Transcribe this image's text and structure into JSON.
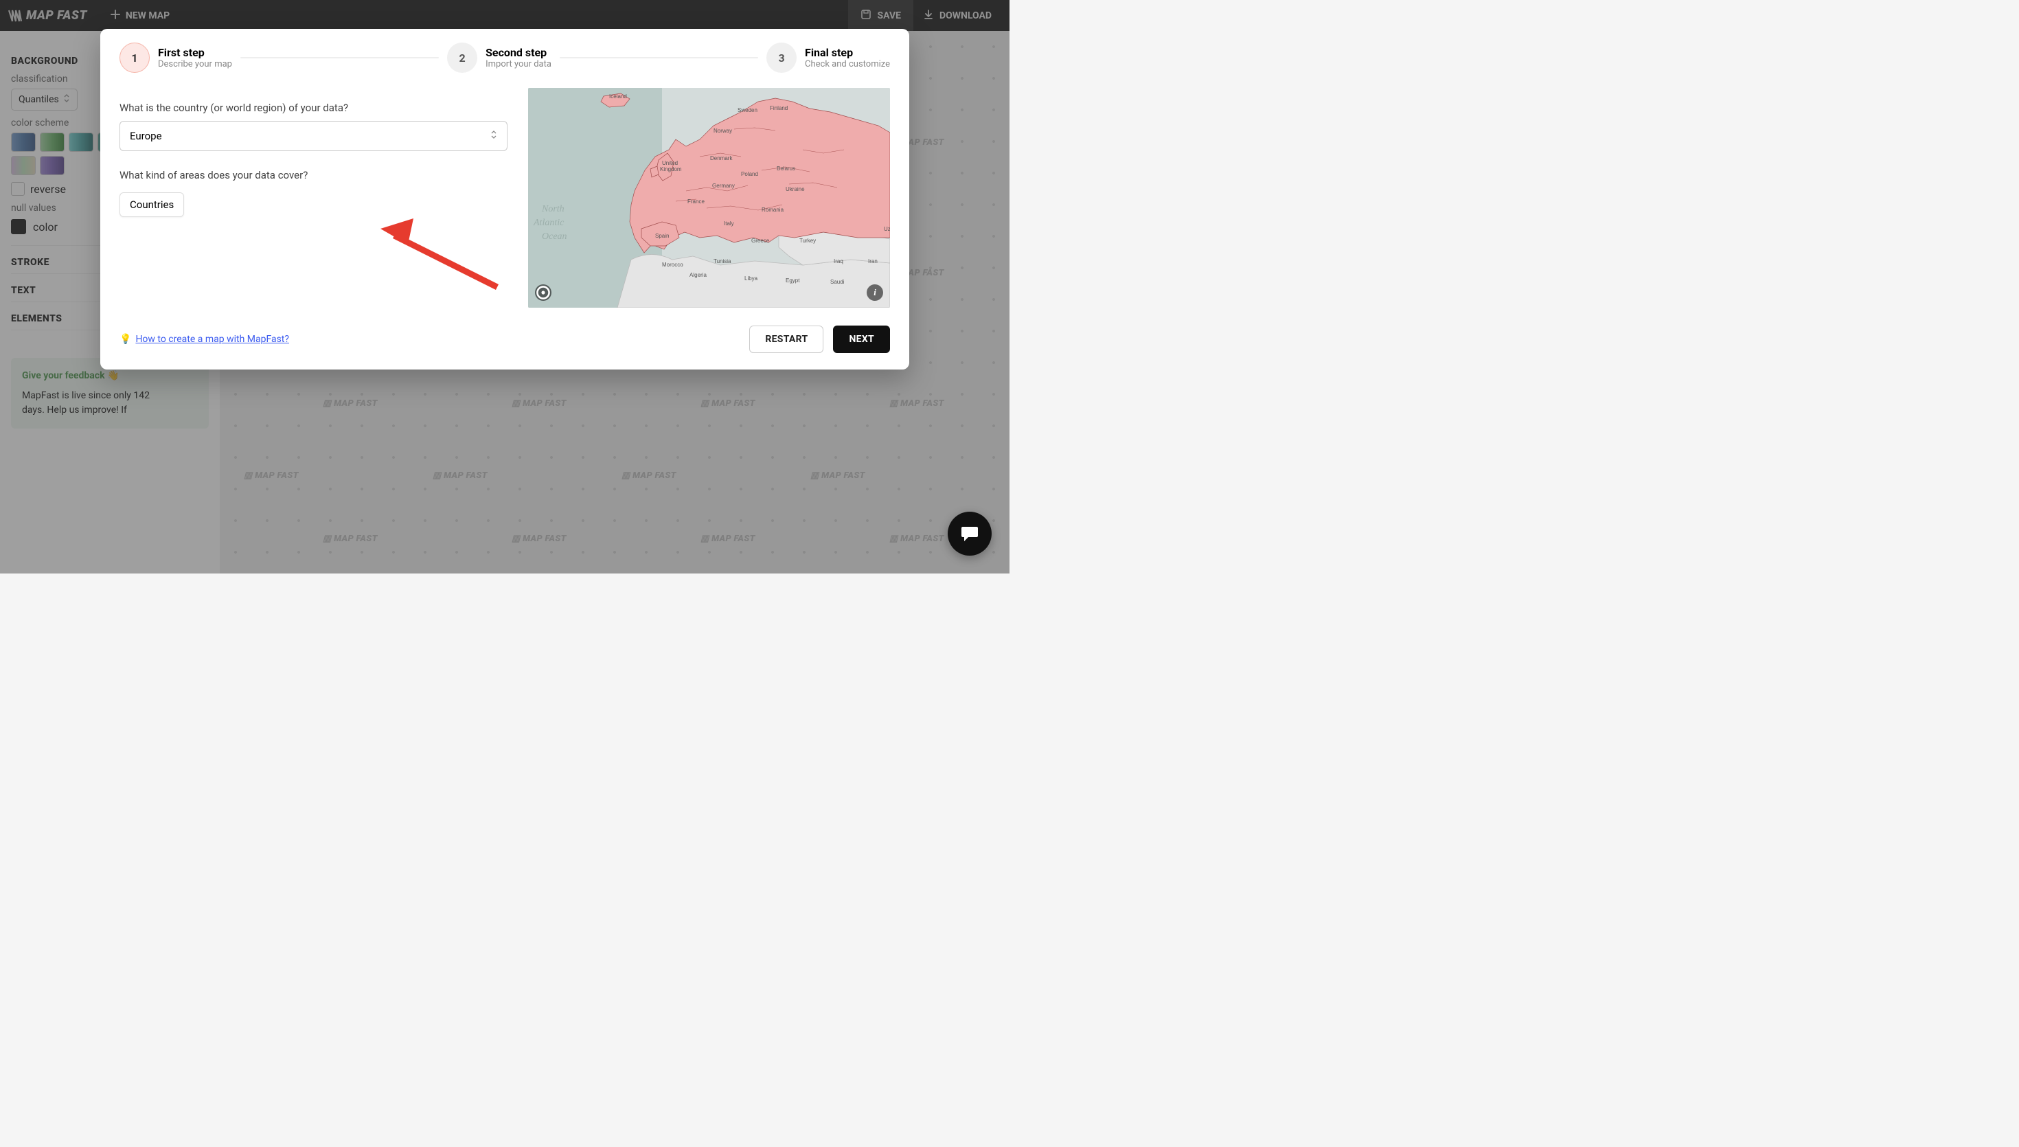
{
  "topbar": {
    "logo_text": "MAP FAST",
    "new_map": "NEW MAP",
    "save": "SAVE",
    "download": "DOWNLOAD"
  },
  "sidebar": {
    "background_title": "BACKGROUND",
    "classification_label": "classification",
    "classification_value": "Quantiles",
    "color_scheme_label": "color scheme",
    "reverse_label": "reverse",
    "null_values_label": "null values",
    "color_label": "color",
    "stroke_title": "STROKE",
    "text_title": "TEXT",
    "elements_title": "ELEMENTS"
  },
  "feedback": {
    "title": "Give your feedback 👋",
    "body_line1": "MapFast is live since only 142",
    "body_line2": "days. Help us improve! If"
  },
  "modal": {
    "steps": {
      "s1_num": "1",
      "s1_title": "First step",
      "s1_sub": "Describe your map",
      "s2_num": "2",
      "s2_title": "Second step",
      "s2_sub": "Import your data",
      "s3_num": "3",
      "s3_title": "Final step",
      "s3_sub": "Check and customize"
    },
    "q1": "What is the country (or world region) of your data?",
    "region_value": "Europe",
    "q2": "What kind of areas does your data cover?",
    "area_value": "Countries",
    "help_text": "How to create a map with MapFast?",
    "restart": "RESTART",
    "next": "NEXT"
  },
  "map_labels": {
    "ocean1": "North",
    "ocean2": "Atlantic",
    "ocean3": "Ocean",
    "countries": {
      "iceland": "Iceland",
      "united": "United",
      "kingdom": "Kingdom",
      "france": "France",
      "spain": "Spain",
      "morocco": "Morocco",
      "algeria": "Algeria",
      "tunisia": "Tunisia",
      "libya": "Libya",
      "egypt": "Egypt",
      "saudi": "Saudi",
      "italy": "Italy",
      "germany": "Germany",
      "poland": "Poland",
      "denmark": "Denmark",
      "norway": "Norway",
      "sweden": "Sweden",
      "finland": "Finland",
      "belarus": "Belarus",
      "ukraine": "Ukraine",
      "romania": "Romania",
      "greece": "Greece",
      "turkey": "Turkey",
      "iraq": "Iraq",
      "iran": "Iran",
      "uz": "Uz"
    }
  },
  "watermark": "▥ MAP FAST"
}
